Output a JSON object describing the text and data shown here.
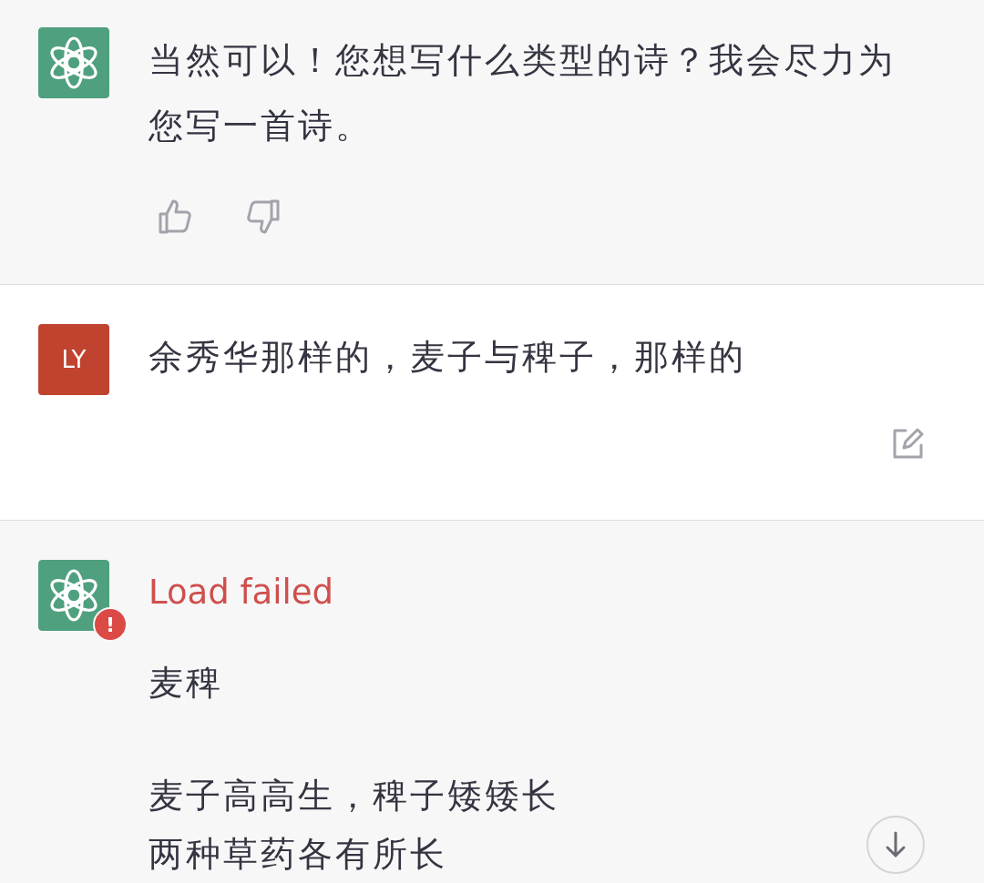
{
  "messages": [
    {
      "kind": "assistant",
      "text": "当然可以！您想写什么类型的诗？我会尽力为您写一首诗。",
      "feedback": true
    },
    {
      "kind": "user",
      "avatar": "LY",
      "text": "余秀华那样的，麦子与稗子，那样的",
      "editable": true
    },
    {
      "kind": "assistant",
      "error": {
        "label": "Load failed",
        "badge": "!"
      },
      "stanzas": [
        [
          "麦稗"
        ],
        [
          "麦子高高生，稗子矮矮长",
          "两种草药各有所长"
        ]
      ]
    }
  ],
  "scroll_down_button": true
}
